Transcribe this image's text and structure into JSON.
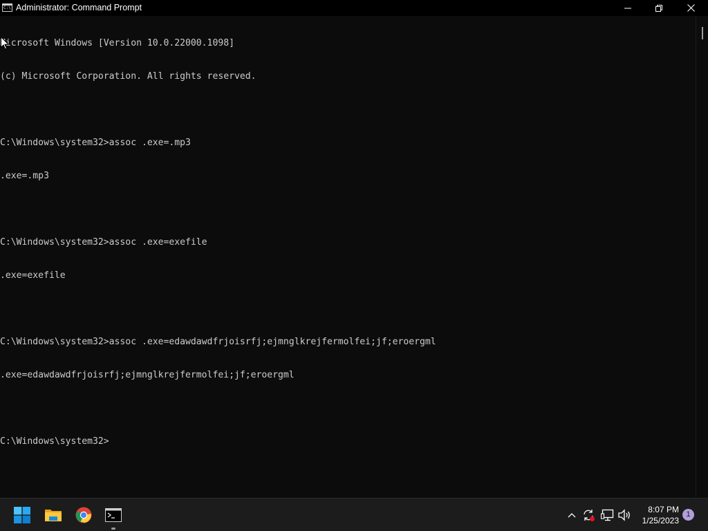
{
  "window": {
    "title": "Administrator: Command Prompt",
    "icon_text": "C:\\"
  },
  "controls": {
    "minimize_icon": "minimize-icon",
    "maximize_icon": "restore-icon",
    "close_icon": "close-icon"
  },
  "console": {
    "lines": [
      "Microsoft Windows [Version 10.0.22000.1098]",
      "(c) Microsoft Corporation. All rights reserved.",
      "",
      "C:\\Windows\\system32>assoc .exe=.mp3",
      ".exe=.mp3",
      "",
      "C:\\Windows\\system32>assoc .exe=exefile",
      ".exe=exefile",
      "",
      "C:\\Windows\\system32>assoc .exe=edawdawdfrjoisrfj;ejmnglkrejfermolfei;jf;eroergml",
      ".exe=edawdawdfrjoisrfj;ejmnglkrejfermolfei;jf;eroergml",
      "",
      "C:\\Windows\\system32>"
    ]
  },
  "taskbar": {
    "apps": [
      {
        "name": "Start",
        "icon": "windows-start-icon"
      },
      {
        "name": "File Explorer",
        "icon": "folder-icon"
      },
      {
        "name": "Google Chrome",
        "icon": "chrome-icon"
      },
      {
        "name": "Command Prompt",
        "icon": "cmd-icon",
        "active": true
      }
    ],
    "tray": {
      "icons": [
        "chevron-up-icon",
        "sync-icon",
        "display-icon",
        "volume-icon"
      ]
    },
    "clock": {
      "time": "8:07 PM",
      "date": "1/25/2023"
    },
    "notification_count": "1"
  },
  "colors": {
    "console_bg": "#0c0c0c",
    "console_fg": "#cccccc",
    "taskbar_bg": "#1c1c1c",
    "accent": "#0078d4",
    "badge": "#b39ddb"
  }
}
